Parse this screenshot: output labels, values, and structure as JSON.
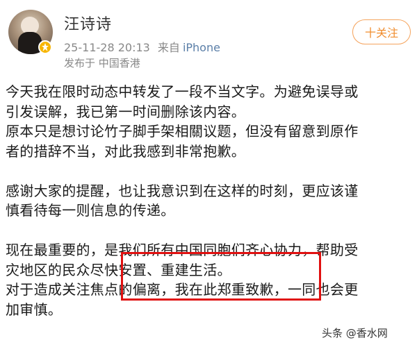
{
  "header": {
    "username": "汪诗诗",
    "timestamp": "25-11-28 20:13",
    "source_prefix": "来自",
    "source": "iPhone",
    "location": "发布于 中国香港",
    "follow_label": "十关注"
  },
  "post": {
    "lines": [
      "今天我在限时动态中转发了一段不当文字。为避免误导或",
      "引发误解，我已第一时间删除该内容。",
      "原本只是想讨论竹子脚手架相關议题，但没有留意到原作",
      "者的措辞不当，对此我感到非常抱歉。",
      "",
      "感谢大家的提醒，也让我意识到在这样的时刻，更应该谨",
      "慎看待每一则信息的传递。",
      "",
      "现在最重要的，是我们所有中国同胞们齐心协力，帮助受",
      "灾地区的民众尽快安置、重建生活。",
      "对于造成关注焦点的偏离，我在此郑重致歉，一同也会更",
      "加审慎。"
    ]
  },
  "watermark": "头条 @香水网",
  "colors": {
    "follow_accent": "#f08d2e",
    "source_link": "#5b7fa8",
    "highlight_box": "#e01010",
    "verify_badge": "#f7b500"
  }
}
